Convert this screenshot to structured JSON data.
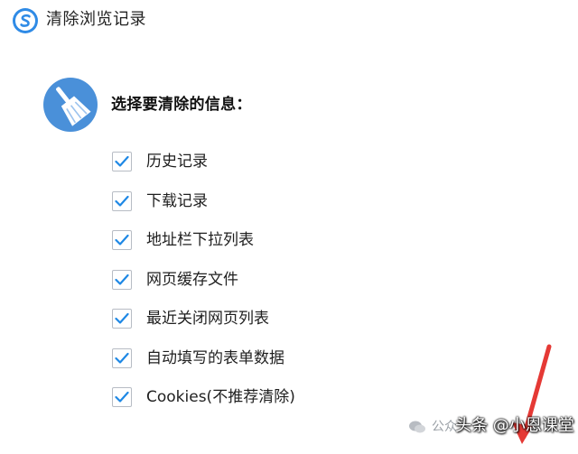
{
  "window": {
    "title": "清除浏览记录"
  },
  "heading": "选择要清除的信息：",
  "options": [
    {
      "label": "历史记录",
      "checked": true
    },
    {
      "label": "下载记录",
      "checked": true
    },
    {
      "label": "地址栏下拉列表",
      "checked": true
    },
    {
      "label": "网页缓存文件",
      "checked": true
    },
    {
      "label": "最近关闭网页列表",
      "checked": true
    },
    {
      "label": "自动填写的表单数据",
      "checked": true
    },
    {
      "label": "Cookies(不推荐清除)",
      "checked": true
    }
  ],
  "watermark": {
    "prefix": "公众",
    "text": "头条 @小恩课堂"
  },
  "colors": {
    "accent": "#1e88e5",
    "check": "#1e88e5",
    "broom_badge": "#4a90d9",
    "annotation_arrow": "#e53935"
  },
  "icons": {
    "app_logo": "browser-logo-icon",
    "badge": "broom-icon",
    "checkbox": "checkmark-icon",
    "watermark": "wechat-icon"
  }
}
